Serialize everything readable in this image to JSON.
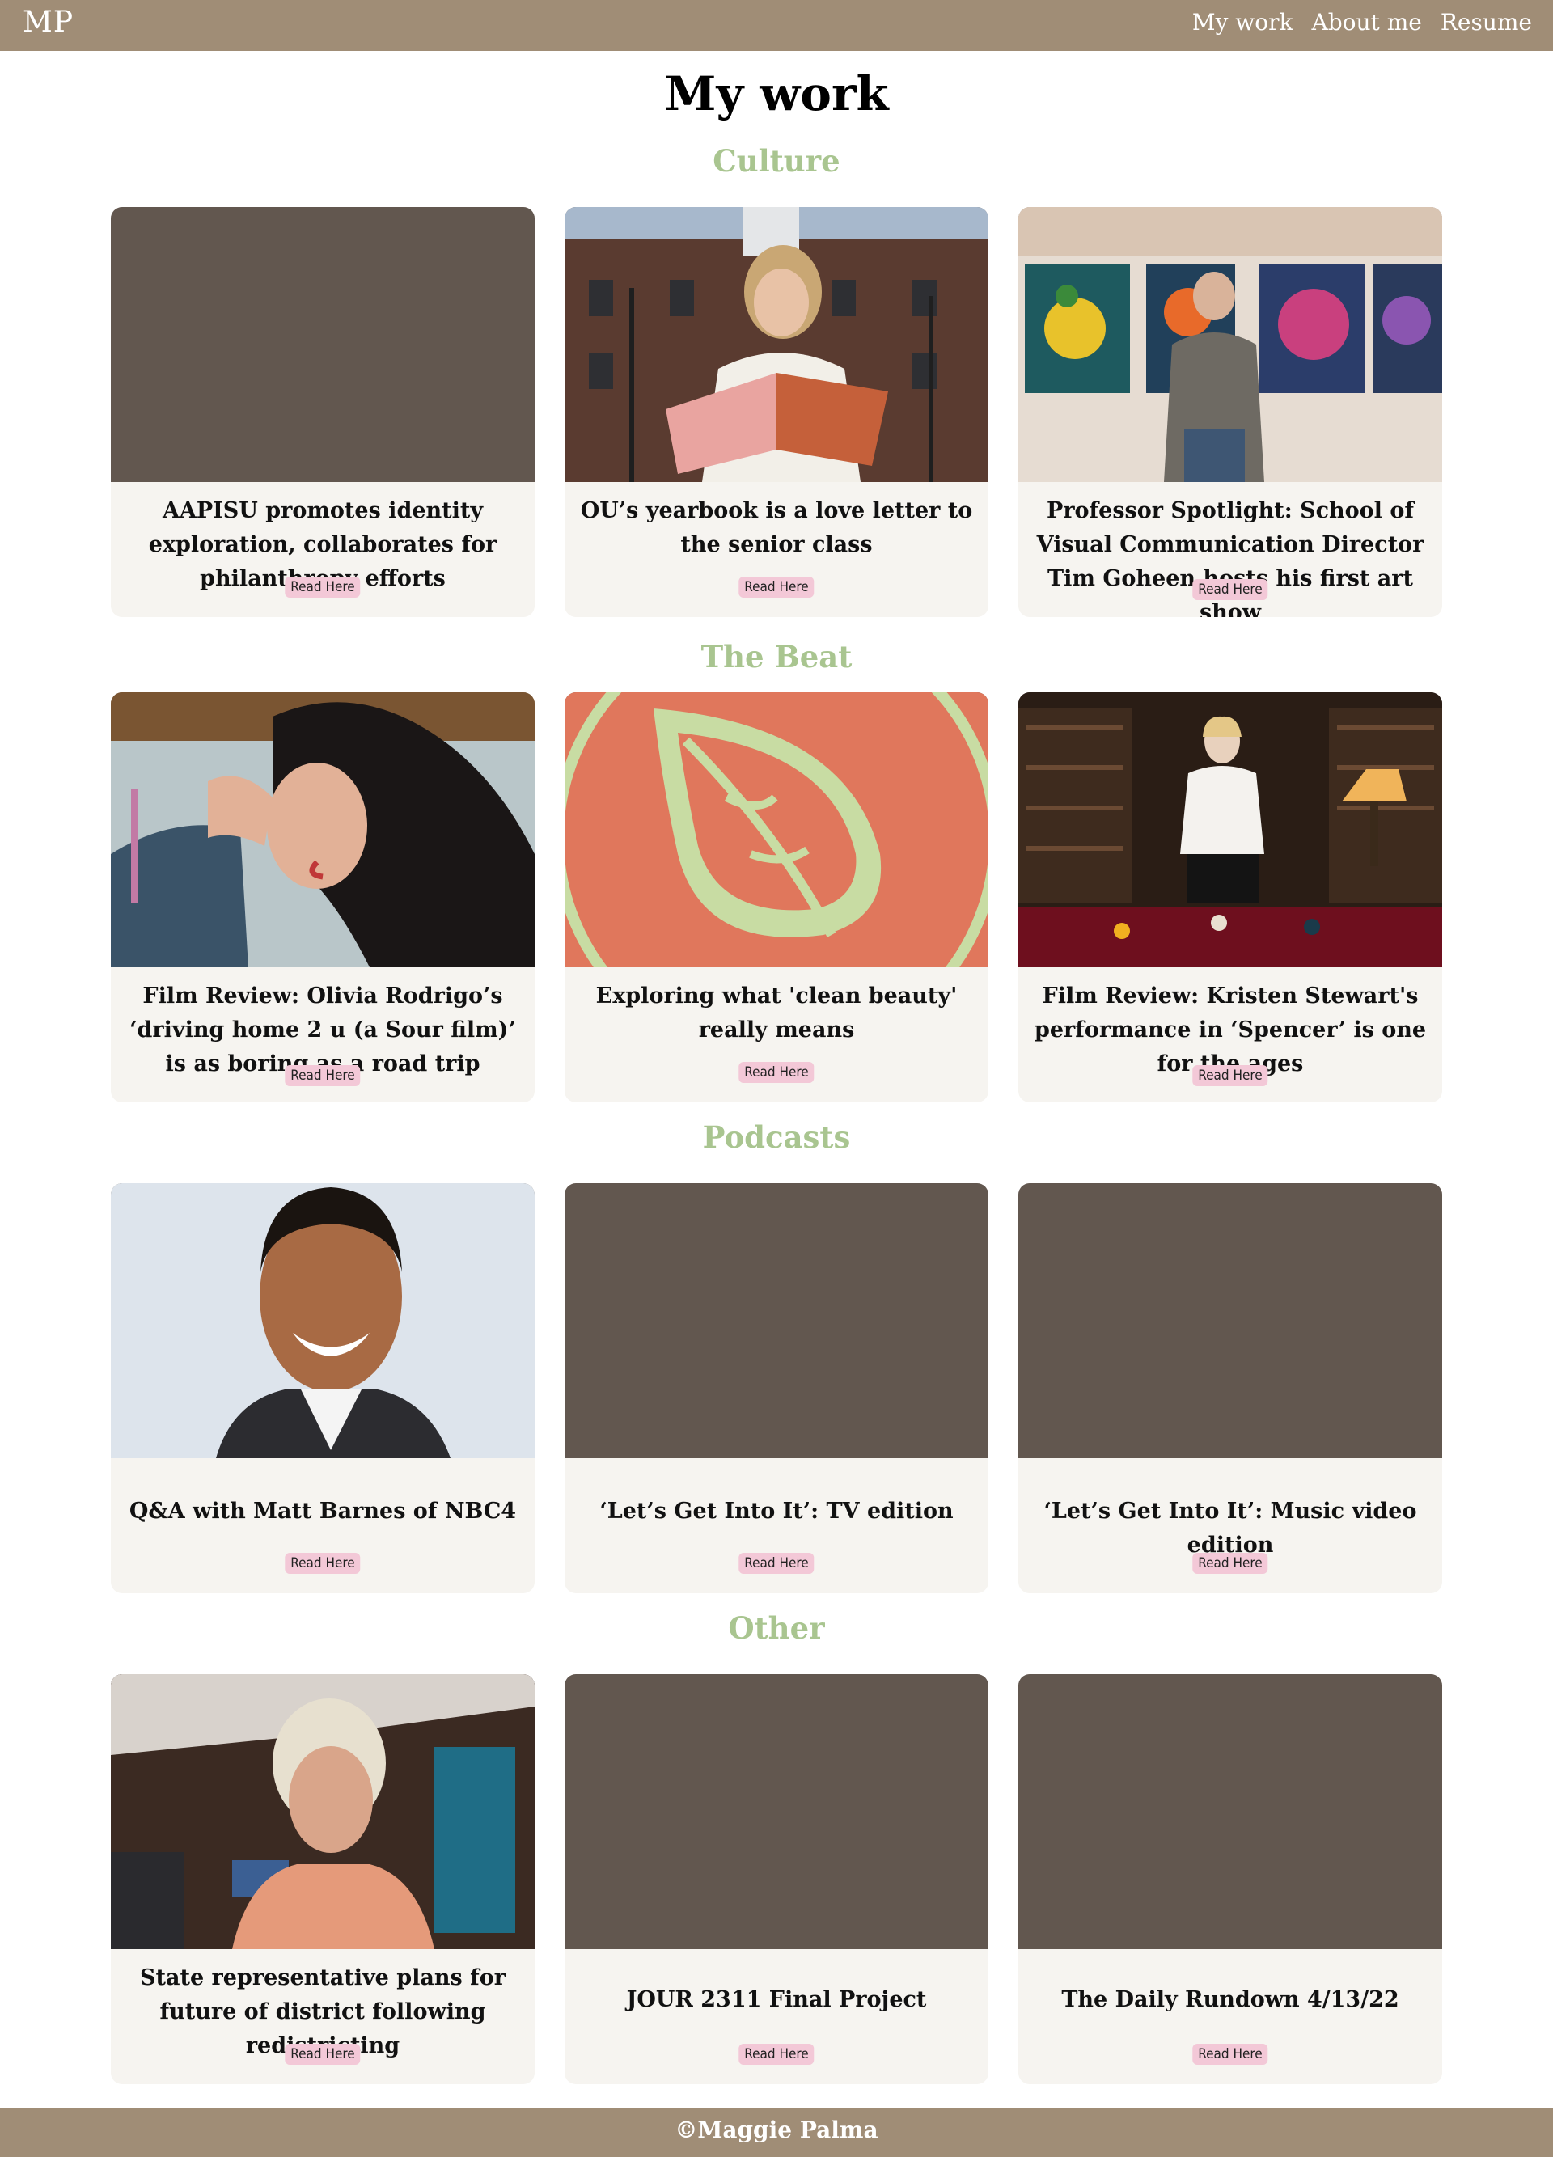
{
  "header": {
    "logo": "MP",
    "nav": [
      {
        "label": "My work"
      },
      {
        "label": "About me"
      },
      {
        "label": "Resume"
      }
    ]
  },
  "main": {
    "title": "My work",
    "sections": [
      {
        "title": "Culture",
        "cards": [
          {
            "title": "AAPISU promotes identity exploration, collaborates for philanthropy efforts",
            "link": "Read Here",
            "image": "placeholder"
          },
          {
            "title": "OU’s yearbook is a love letter to the senior class",
            "link": "Read Here",
            "image": "woman-reading-yearbook-photo"
          },
          {
            "title": "Professor Spotlight: School of Visual Communication Director Tim Goheen hosts his first art show",
            "link": "Read Here",
            "image": "man-with-flower-paintings-photo"
          }
        ]
      },
      {
        "title": "The Beat",
        "cards": [
          {
            "title": "Film Review: Olivia Rodrigo’s ‘driving home 2 u (a Sour film)’ is as boring as a road trip",
            "link": "Read Here",
            "image": "olivia-rodrigo-portrait-photo"
          },
          {
            "title": "Exploring what 'clean beauty' really means",
            "link": "Read Here",
            "image": "leaf-illustration"
          },
          {
            "title": "Film Review: Kristen Stewart's performance in ‘Spencer’ is one for the ages",
            "link": "Read Here",
            "image": "spencer-billiards-room-photo"
          }
        ]
      },
      {
        "title": "Podcasts",
        "cards": [
          {
            "title": "Q&A with Matt Barnes of NBC4",
            "link": "Read Here",
            "image": "matt-barnes-headshot-photo"
          },
          {
            "title": "‘Let’s Get Into It’: TV edition",
            "link": "Read Here",
            "image": "placeholder"
          },
          {
            "title": "‘Let’s Get Into It’: Music video edition",
            "link": "Read Here",
            "image": "placeholder"
          }
        ]
      },
      {
        "title": "Other",
        "cards": [
          {
            "title": "State representative plans for future of district following redistricting",
            "link": "Read Here",
            "image": "state-representative-video-photo"
          },
          {
            "title": "JOUR 2311 Final Project",
            "link": "Read Here",
            "image": "placeholder"
          },
          {
            "title": "The Daily Rundown 4/13/22",
            "link": "Read Here",
            "image": "placeholder"
          }
        ]
      }
    ]
  },
  "footer": {
    "text": "©Maggie Palma"
  },
  "colors": {
    "bar": "#a08d76",
    "section_title": "#a9c590",
    "card_bg": "#f6f4f0",
    "placeholder": "#62574f",
    "badge": "#f3c8d7"
  }
}
